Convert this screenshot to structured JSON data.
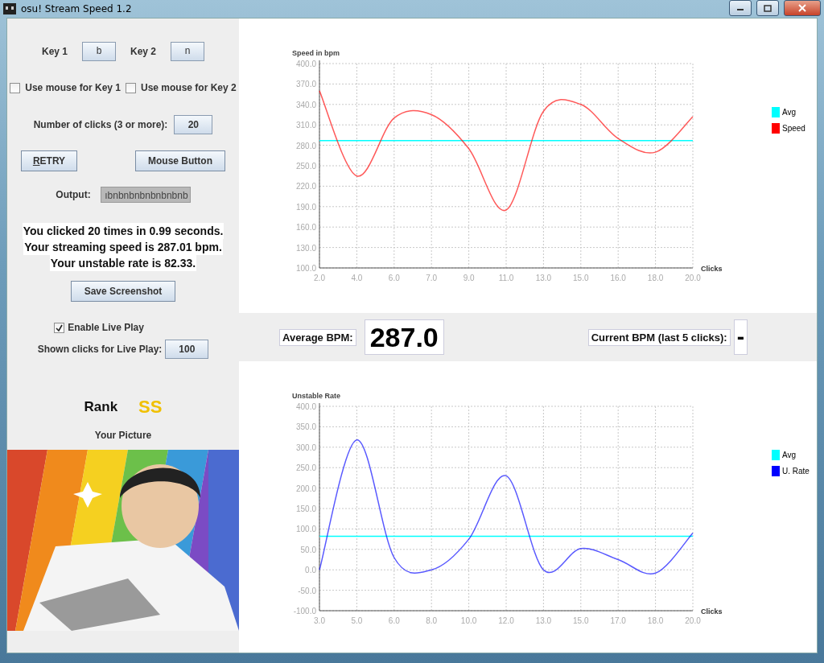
{
  "window": {
    "title": "osu! Stream Speed 1.2"
  },
  "left_panel": {
    "keys": [
      {
        "label": "Key 1",
        "value": "b"
      },
      {
        "label": "Key 2",
        "value": "n"
      }
    ],
    "mouse_options": [
      {
        "label": "Use mouse for Key 1",
        "checked": false
      },
      {
        "label": "Use mouse for Key 2",
        "checked": false
      }
    ],
    "clicks": {
      "label": "Number of clicks (3 or more):",
      "value": "20"
    },
    "buttons": [
      "RETRY",
      "Mouse Button"
    ],
    "output": {
      "label": "Output:",
      "value": "ıbnbnbnbnbnbnbnb"
    },
    "results": [
      "You clicked 20 times in 0.99 seconds.",
      "Your streaming speed is 287.01 bpm.",
      "Your unstable rate is 82.33."
    ],
    "save_button": "Save Screenshot",
    "live_play": {
      "label": "Enable Live Play",
      "checked": true
    },
    "shown_clicks": {
      "label": "Shown clicks for Live Play:",
      "value": "100"
    },
    "rank": {
      "label": "Rank",
      "value": "SS"
    },
    "picture": {
      "label": "Your Picture",
      "kind": "picture"
    }
  },
  "speed_chart": {
    "chart_data": {
      "type": "line",
      "title": "Speed in bpm",
      "xlabel": "Clicks",
      "categories": [
        "2.0",
        "4.0",
        "6.0",
        "7.0",
        "9.0",
        "11.0",
        "13.0",
        "15.0",
        "16.0",
        "18.0",
        "20.0"
      ],
      "series": [
        {
          "name": "Avg",
          "color": "#00ffff",
          "values": [
            287,
            287,
            287,
            287,
            287,
            287,
            287,
            287,
            287,
            287,
            287
          ]
        },
        {
          "name": "Speed",
          "color": "#ff0000",
          "values": [
            360,
            235,
            320,
            325,
            275,
            185,
            330,
            340,
            290,
            270,
            322
          ]
        }
      ],
      "ylim": [
        100,
        400
      ],
      "grid": true,
      "legend": true,
      "yticks": [
        {
          "value": 100,
          "label": "100.0"
        },
        {
          "value": 130,
          "label": "130.0"
        },
        {
          "value": 160,
          "label": "160.0"
        },
        {
          "value": 190,
          "label": "190.0"
        },
        {
          "value": 220,
          "label": "220.0"
        },
        {
          "value": 250,
          "label": "250.0"
        },
        {
          "value": 280,
          "label": "280.0"
        },
        {
          "value": 310,
          "label": "310.0"
        },
        {
          "value": 340,
          "label": "340.0"
        },
        {
          "value": 370,
          "label": "370.0"
        },
        {
          "value": 400,
          "label": "400.0"
        }
      ]
    }
  },
  "stats": {
    "average": {
      "label": "Average BPM:",
      "value": "287.0"
    },
    "current": {
      "label": "Current BPM (last 5 clicks):",
      "value": "-"
    }
  },
  "ur_chart": {
    "chart_data": {
      "type": "line",
      "title": "Unstable Rate",
      "xlabel": "Clicks",
      "categories": [
        "3.0",
        "5.0",
        "6.0",
        "8.0",
        "10.0",
        "12.0",
        "13.0",
        "15.0",
        "17.0",
        "18.0",
        "20.0"
      ],
      "series": [
        {
          "name": "Avg",
          "color": "#00ffff",
          "values": [
            82,
            82,
            82,
            82,
            82,
            82,
            82,
            82,
            82,
            82,
            82
          ]
        },
        {
          "name": "U. Rate",
          "color": "#0000ff",
          "values": [
            0,
            318,
            30,
            0,
            75,
            230,
            0,
            52,
            25,
            -8,
            90
          ]
        }
      ],
      "ylim": [
        -100,
        400
      ],
      "grid": true,
      "legend": true,
      "yticks": [
        {
          "value": -100,
          "label": "-100.0"
        },
        {
          "value": -50,
          "label": "-50.0"
        },
        {
          "value": 0,
          "label": "0.0"
        },
        {
          "value": 50,
          "label": "50.0"
        },
        {
          "value": 100,
          "label": "100.0"
        },
        {
          "value": 150,
          "label": "150.0"
        },
        {
          "value": 200,
          "label": "200.0"
        },
        {
          "value": 250,
          "label": "250.0"
        },
        {
          "value": 300,
          "label": "300.0"
        },
        {
          "value": 350,
          "label": "350.0"
        },
        {
          "value": 400,
          "label": "400.0"
        }
      ]
    }
  }
}
